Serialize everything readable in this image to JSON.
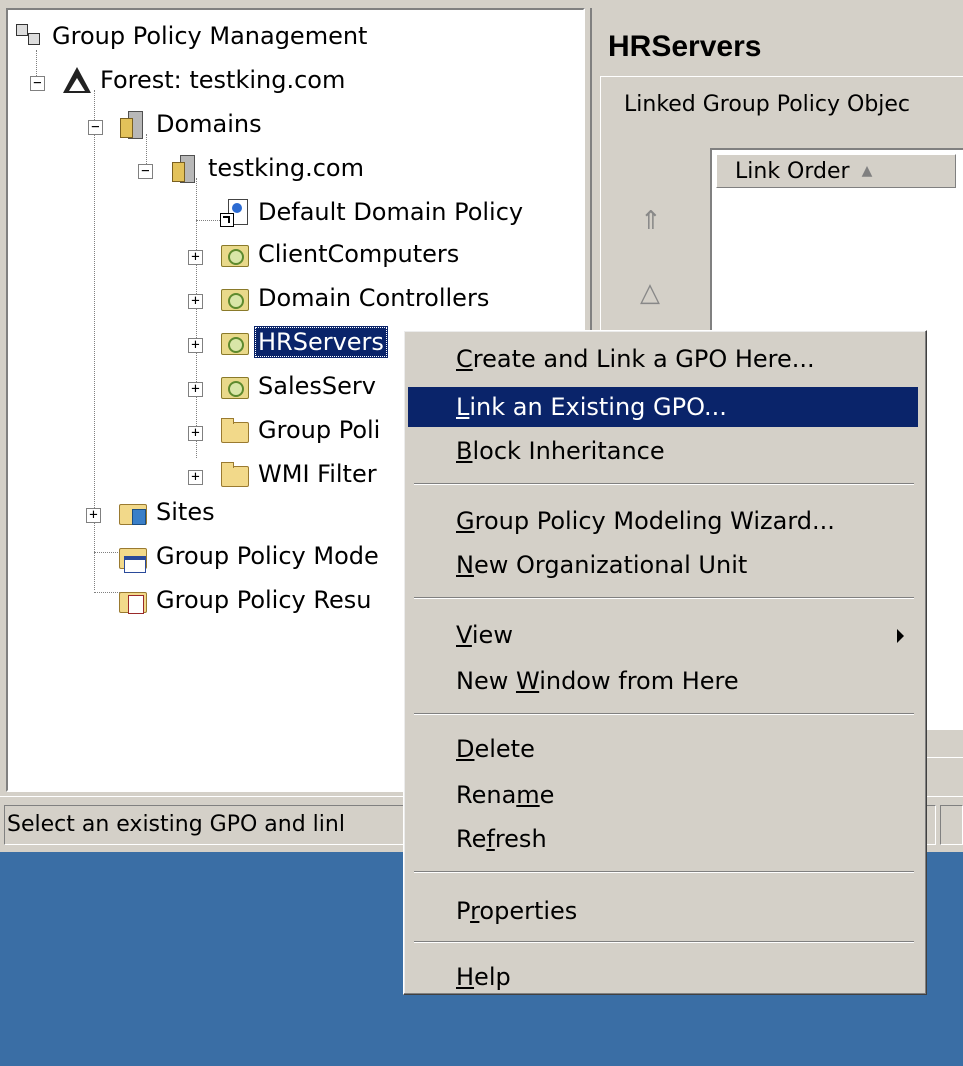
{
  "tree": {
    "items": [
      {
        "label": "Group Policy Management",
        "icon": "gpm-icon"
      },
      {
        "label": "Forest: testking.com",
        "icon": "forest-icon"
      },
      {
        "label": "Domains",
        "icon": "domains-icon"
      },
      {
        "label": "testking.com",
        "icon": "domain-icon"
      },
      {
        "label": "Default Domain Policy",
        "icon": "gpo-link-icon"
      },
      {
        "label": "ClientComputers",
        "icon": "ou-icon"
      },
      {
        "label": "Domain Controllers",
        "icon": "ou-icon"
      },
      {
        "label": "HRServers",
        "icon": "ou-icon",
        "selected": true
      },
      {
        "label": "SalesServ",
        "icon": "ou-icon"
      },
      {
        "label": "Group Poli",
        "icon": "gpo-folder-icon"
      },
      {
        "label": "WMI Filter",
        "icon": "wmi-folder-icon"
      },
      {
        "label": "Sites",
        "icon": "sites-folder-icon"
      },
      {
        "label": "Group Policy Mode",
        "icon": "modeling-folder-icon"
      },
      {
        "label": "Group Policy Resu",
        "icon": "results-folder-icon"
      }
    ]
  },
  "right_pane": {
    "title": "HRServers",
    "tab_label": "Linked Group Policy Objec",
    "column_header": "Link Order"
  },
  "statusbar": {
    "text": "Select an existing GPO and linl"
  },
  "context_menu": {
    "items": [
      {
        "label": "Create and Link a GPO Here...",
        "mnemonic": "C"
      },
      {
        "label": "Link an Existing GPO...",
        "mnemonic": "L",
        "highlighted": true
      },
      {
        "label": "Block Inheritance",
        "mnemonic": "B"
      },
      {
        "label": "Group Policy Modeling Wizard...",
        "mnemonic": "G"
      },
      {
        "label": "New Organizational Unit",
        "mnemonic": "N"
      },
      {
        "label": "View",
        "mnemonic": "V",
        "submenu": true
      },
      {
        "label": "New Window from Here",
        "mnemonic": "W"
      },
      {
        "label": "Delete",
        "mnemonic": "D"
      },
      {
        "label": "Rename",
        "mnemonic": "m"
      },
      {
        "label": "Refresh",
        "mnemonic": "f"
      },
      {
        "label": "Properties",
        "mnemonic": "r"
      },
      {
        "label": "Help",
        "mnemonic": "H"
      }
    ]
  },
  "colors": {
    "highlight": "#0a246a",
    "face": "#d4d0c8",
    "desktop": "#3a6ea5"
  }
}
